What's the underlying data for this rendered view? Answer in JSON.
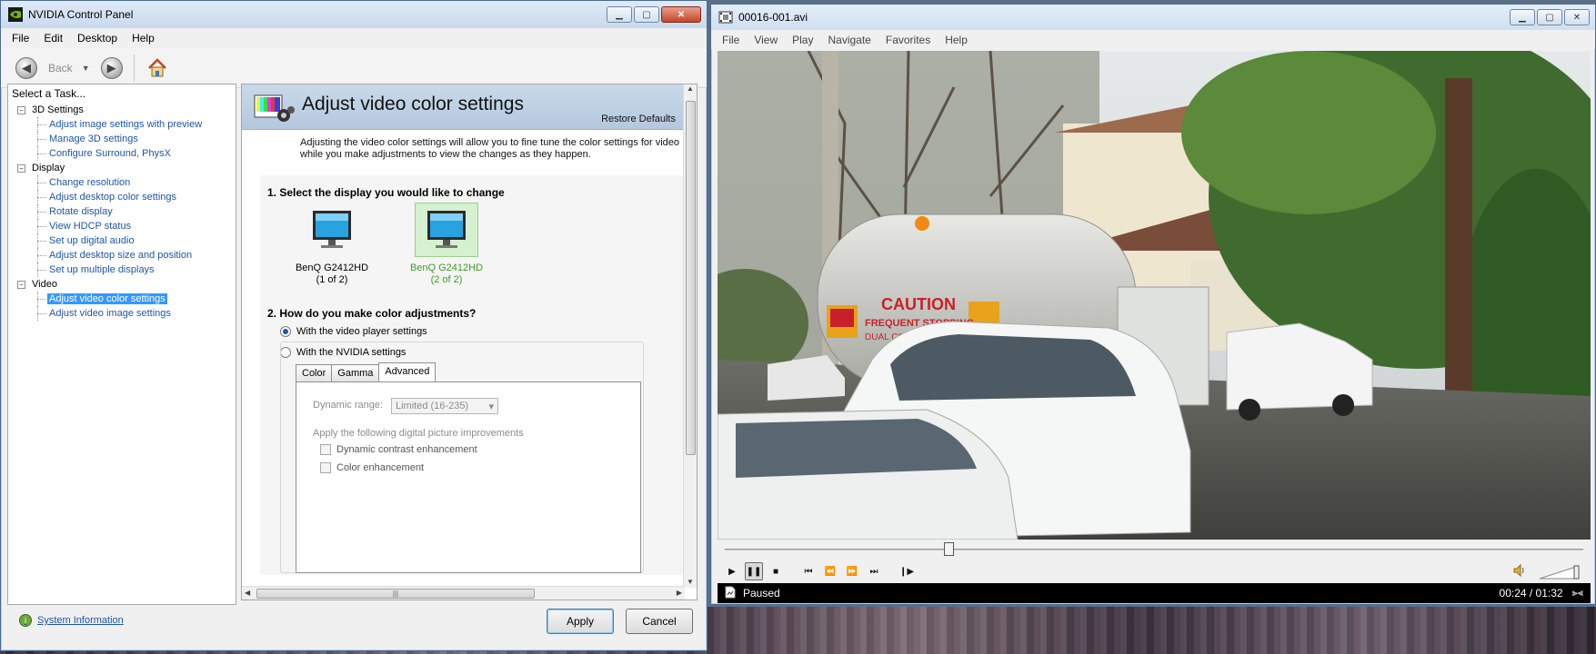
{
  "nvidia": {
    "title": "NVIDIA Control Panel",
    "menu": [
      "File",
      "Edit",
      "Desktop",
      "Help"
    ],
    "toolbar": {
      "back_label": "Back"
    },
    "task_title": "Select a Task...",
    "tree": [
      {
        "label": "3D Settings",
        "children": [
          "Adjust image settings with preview",
          "Manage 3D settings",
          "Configure Surround, PhysX"
        ]
      },
      {
        "label": "Display",
        "children": [
          "Change resolution",
          "Adjust desktop color settings",
          "Rotate display",
          "View HDCP status",
          "Set up digital audio",
          "Adjust desktop size and position",
          "Set up multiple displays"
        ]
      },
      {
        "label": "Video",
        "children": [
          "Adjust video color settings",
          "Adjust video image settings"
        ]
      }
    ],
    "selected_task": "Adjust video color settings",
    "system_info": "System Information",
    "page": {
      "title": "Adjust video color settings",
      "restore_defaults": "Restore Defaults",
      "description_1": "Adjusting the video color settings will allow you to fine tune the color settings for video cont",
      "description_2": "while you make adjustments to view the changes as they happen.",
      "section1": "1. Select the display you would like to change",
      "displays": [
        {
          "name": "BenQ G2412HD",
          "index": "(1 of 2)",
          "selected": false
        },
        {
          "name": "BenQ G2412HD",
          "index": "(2 of 2)",
          "selected": true
        }
      ],
      "section2": "2. How do you make color adjustments?",
      "option_player": "With the video player settings",
      "option_nvidia": "With the NVIDIA settings",
      "tabs": [
        "Color",
        "Gamma",
        "Advanced"
      ],
      "active_tab": "Advanced",
      "dynamic_range_label": "Dynamic range:",
      "dynamic_range_value": "Limited (16-235)",
      "improvements_label": "Apply the following digital picture improvements",
      "check_contrast": "Dynamic contrast enhancement",
      "check_color": "Color enhancement"
    },
    "apply": "Apply",
    "cancel": "Cancel"
  },
  "player": {
    "title": "00016-001.avi",
    "menu": [
      "File",
      "View",
      "Play",
      "Navigate",
      "Favorites",
      "Help"
    ],
    "video_text": {
      "caution": "CAUTION",
      "frequent": "FREQUENT STOPPING",
      "dual": "DUAL CONTROL"
    },
    "status": "Paused",
    "time": "00:24 / 01:32",
    "progress_fraction": 0.261
  },
  "colors": {
    "link": "#1f55a8",
    "selection": "#3399ff",
    "nvidia_green": "#76b900",
    "selected_display_text": "#3ca01e"
  }
}
